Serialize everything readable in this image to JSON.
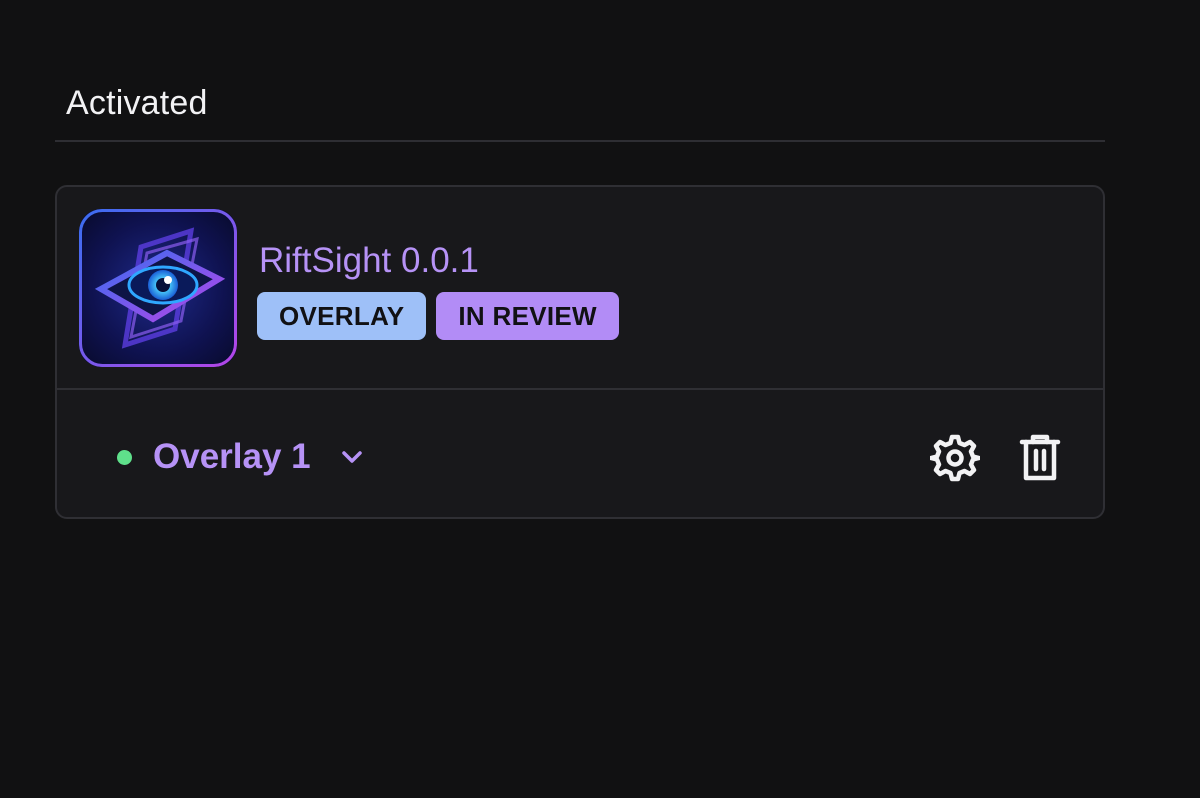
{
  "section": {
    "title": "Activated"
  },
  "app": {
    "name": "RiftSight 0.0.1",
    "icon": "eye-logo-icon",
    "badges": [
      {
        "label": "OVERLAY",
        "color": "#9ec0f8"
      },
      {
        "label": "IN REVIEW",
        "color": "#b28cf6"
      }
    ]
  },
  "overlay": {
    "status": "active",
    "status_color": "#5fe08b",
    "selected": "Overlay 1",
    "accent_color": "#b692f6"
  },
  "actions": {
    "settings_icon": "gear-icon",
    "delete_icon": "trash-icon"
  }
}
